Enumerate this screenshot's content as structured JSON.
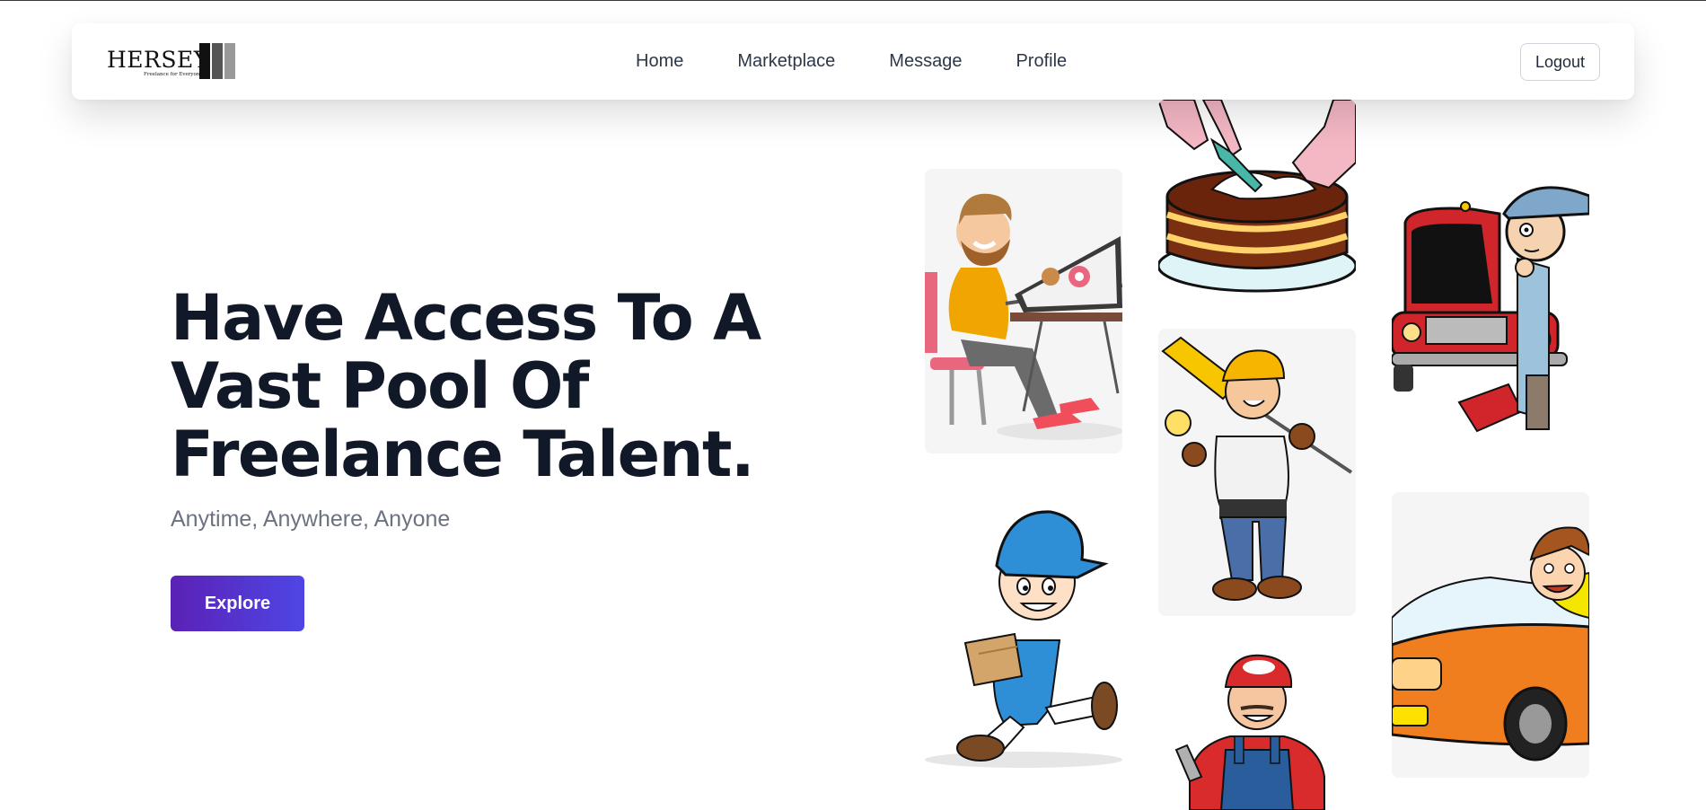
{
  "brand": {
    "name": "HERSEY",
    "tagline": "Freelance for Everyone"
  },
  "nav": {
    "items": [
      "Home",
      "Marketplace",
      "Message",
      "Profile"
    ],
    "logout_label": "Logout"
  },
  "hero": {
    "title_lines": [
      "Have Access To A",
      "Vast Pool Of",
      "Freelance Talent."
    ],
    "subtitle": "Anytime, Anywhere, Anyone",
    "cta_label": "Explore"
  },
  "colors": {
    "cta_gradient_start": "#5b21b6",
    "cta_gradient_end": "#4f46e5",
    "heading": "#111827",
    "subtitle": "#6b7280",
    "nav_text": "#2d3748"
  },
  "illustrations": [
    "designer-illustration",
    "baker-cake-illustration",
    "car-mechanic-illustration",
    "handyman-illustration",
    "delivery-boy-illustration",
    "driver-car-illustration",
    "plumber-illustration"
  ]
}
